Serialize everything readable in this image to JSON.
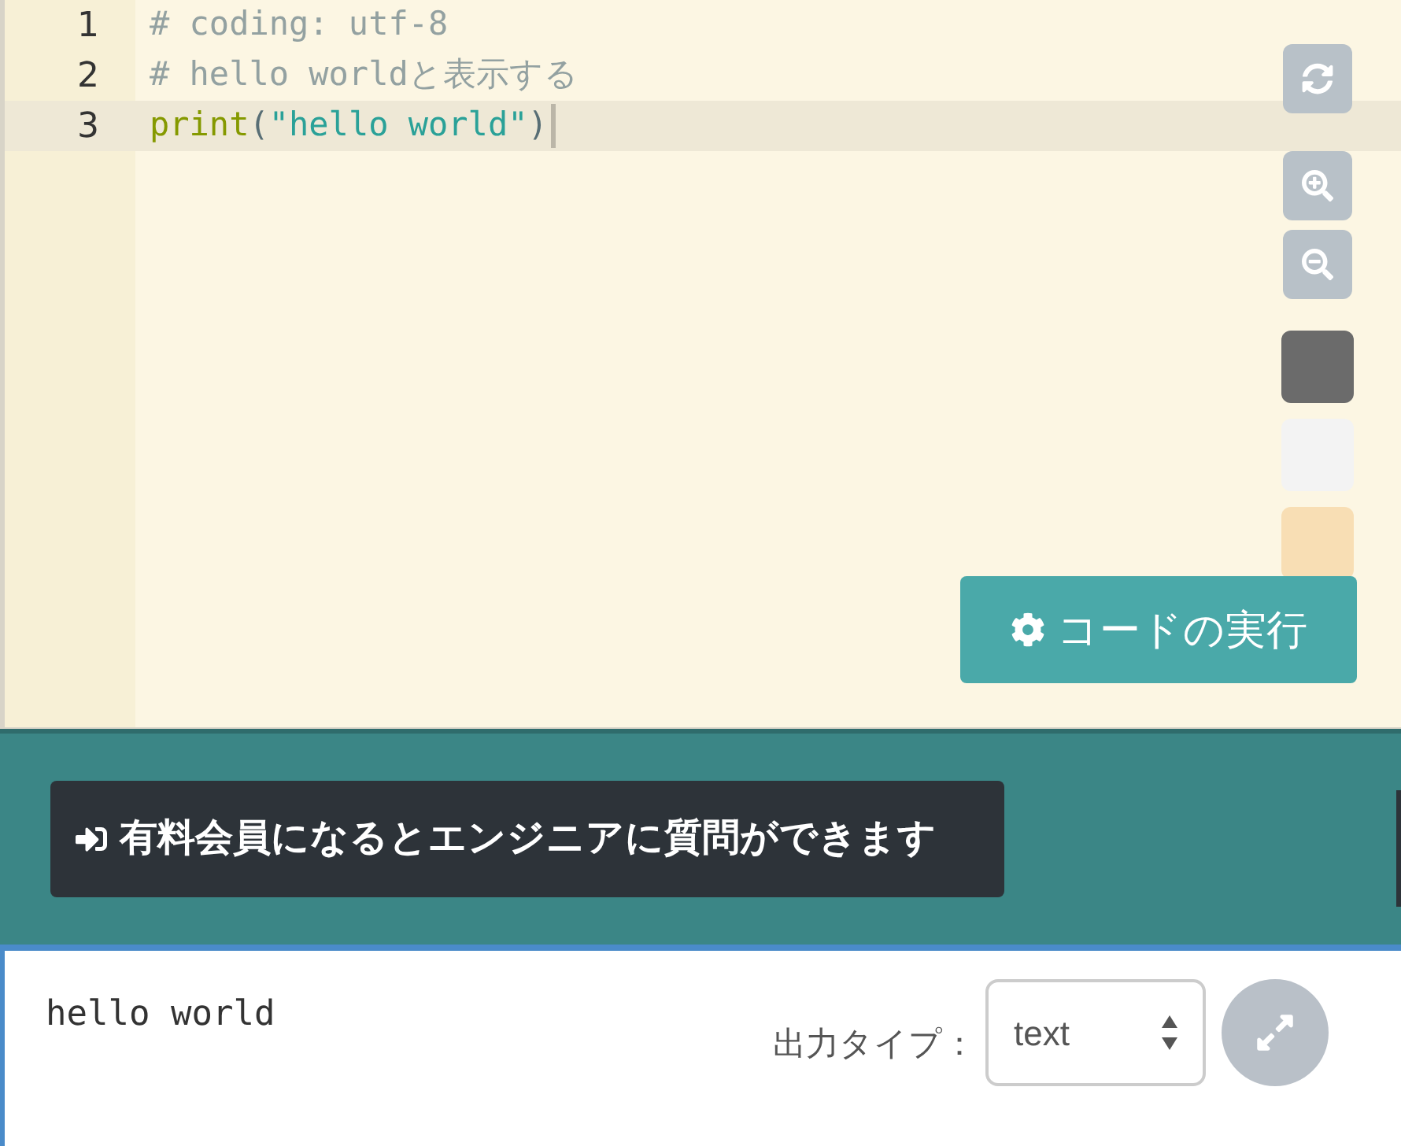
{
  "editor": {
    "lines": [
      {
        "number": "1",
        "active": false,
        "tokens": [
          {
            "kind": "comment",
            "text": "# coding: utf-8"
          }
        ]
      },
      {
        "number": "2",
        "active": false,
        "tokens": [
          {
            "kind": "comment",
            "text": "# hello worldと表示する"
          }
        ]
      },
      {
        "number": "3",
        "active": true,
        "tokens": [
          {
            "kind": "builtin",
            "text": "print"
          },
          {
            "kind": "paren",
            "text": "("
          },
          {
            "kind": "string",
            "text": "\"hello world\""
          },
          {
            "kind": "paren",
            "text": ")"
          }
        ]
      }
    ],
    "themes": [
      {
        "color": "#6b6b6b"
      },
      {
        "color": "#f3f3f3"
      },
      {
        "color": "#f8deb4"
      }
    ],
    "run_button": "コードの実行"
  },
  "banner": {
    "button": "有料会員になるとエンジニアに質問ができます"
  },
  "output": {
    "text": "hello world",
    "type_label": "出力タイプ：",
    "type_value": "text"
  }
}
